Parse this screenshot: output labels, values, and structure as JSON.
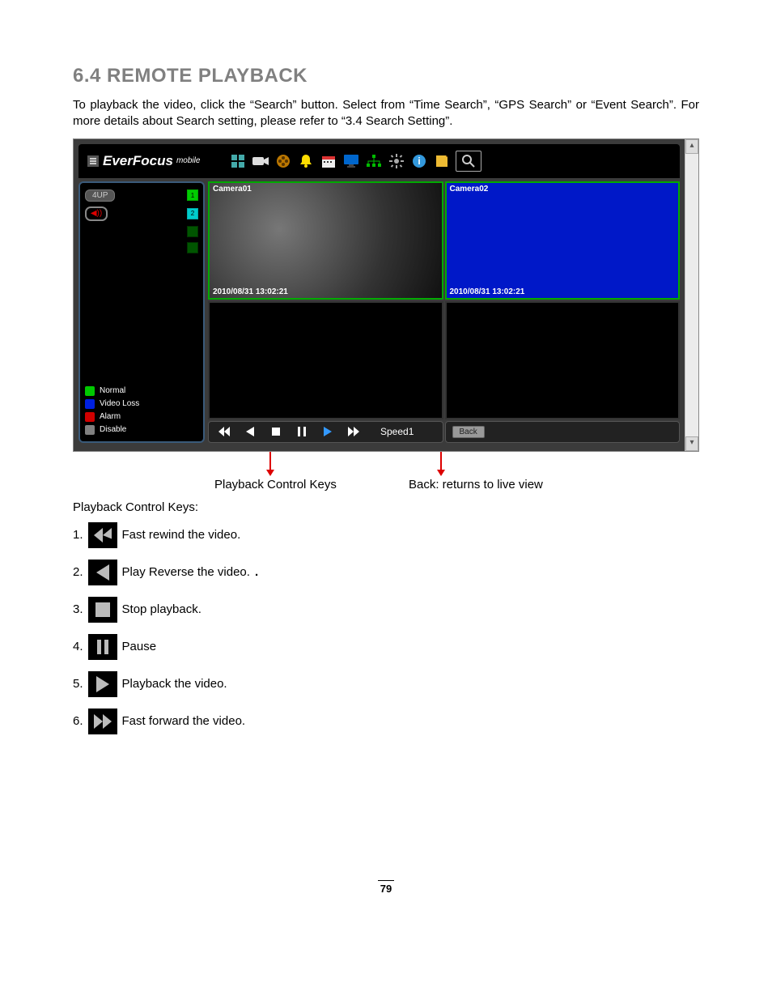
{
  "section": {
    "number": "6.4",
    "title": "REMOTE PLAYBACK"
  },
  "intro": "To playback the video, click the “Search” button. Select from “Time Search”, “GPS Search” or “Event Search”. For more details about Search setting, please refer to “3.4 Search Setting”.",
  "brand": {
    "name": "EverFocus",
    "sup": "mobile"
  },
  "sidebar": {
    "fourup": "4UP",
    "channels": [
      "1",
      "2",
      "",
      ""
    ],
    "legend": [
      {
        "color": "#00c800",
        "label": "Normal"
      },
      {
        "color": "#0020e0",
        "label": "Video Loss"
      },
      {
        "color": "#d00000",
        "label": "Alarm"
      },
      {
        "color": "#808080",
        "label": "Disable"
      }
    ]
  },
  "cameras": [
    {
      "name": "Camera01",
      "ts": "2010/08/31  13:02:21",
      "style": "gray"
    },
    {
      "name": "Camera02",
      "ts": "2010/08/31  13:02:21",
      "style": "blue"
    },
    {
      "name": "",
      "ts": "",
      "style": "black"
    },
    {
      "name": "",
      "ts": "",
      "style": "black"
    }
  ],
  "controls": {
    "speed": "Speed1",
    "back": "Back"
  },
  "annotations": {
    "playback": "Playback Control Keys",
    "back": "Back: returns to live view"
  },
  "keys_heading": "Playback Control Keys:",
  "keys": [
    {
      "n": "1.",
      "desc": "Fast rewind the video."
    },
    {
      "n": "2.",
      "desc": "Play Reverse the video."
    },
    {
      "n": "3.",
      "desc": "Stop playback."
    },
    {
      "n": "4.",
      "desc": "Pause"
    },
    {
      "n": "5.",
      "desc": "Playback the video."
    },
    {
      "n": "6.",
      "desc": "Fast forward the video."
    }
  ],
  "page_number": "79"
}
